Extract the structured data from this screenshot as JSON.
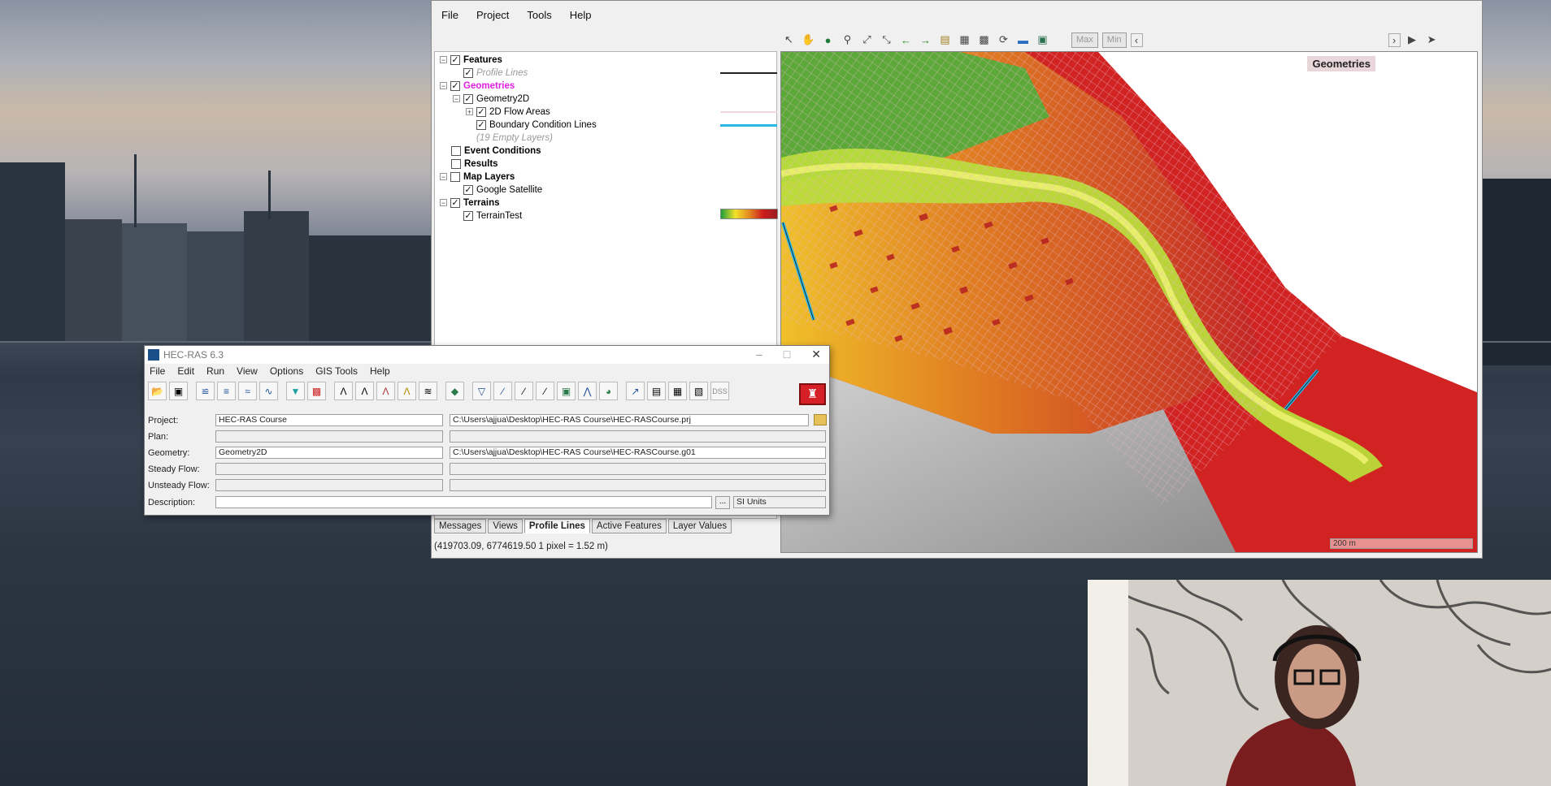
{
  "mapper": {
    "menu": [
      "File",
      "Project",
      "Tools",
      "Help"
    ],
    "toolbar_boxes": [
      "Max",
      "Min"
    ],
    "tree": {
      "features": "Features",
      "profile_lines": "Profile Lines",
      "geometries": "Geometries",
      "geometry2d": "Geometry2D",
      "flow_areas": "2D Flow Areas",
      "bc_lines": "Boundary Condition Lines",
      "empty_layers": "(19 Empty Layers)",
      "event_conditions": "Event Conditions",
      "results": "Results",
      "map_layers": "Map Layers",
      "google_satellite": "Google Satellite",
      "terrains": "Terrains",
      "terrain_test": "TerrainTest"
    },
    "tabs": [
      "Messages",
      "Views",
      "Profile Lines",
      "Active Features",
      "Layer Values"
    ],
    "active_tab": "Profile Lines",
    "status": "(419703.09, 6774619.50  1 pixel = 1.52 m)",
    "map_label": "Geometries",
    "scale_label": "200 m",
    "colors": {
      "geometries_text": "#e020e0",
      "bc_line": "#2ab7e8",
      "profile_line": "#222222"
    }
  },
  "hecras": {
    "title": "HEC-RAS 6.3",
    "menu": [
      "File",
      "Edit",
      "Run",
      "View",
      "Options",
      "GIS Tools",
      "Help"
    ],
    "fields": {
      "project_label": "Project:",
      "project_value": "HEC-RAS Course",
      "project_path": "C:\\Users\\ajjua\\Desktop\\HEC-RAS Course\\HEC-RASCourse.prj",
      "plan_label": "Plan:",
      "geometry_label": "Geometry:",
      "geometry_value": "Geometry2D",
      "geometry_path": "C:\\Users\\ajjua\\Desktop\\HEC-RAS Course\\HEC-RASCourse.g01",
      "steady_label": "Steady Flow:",
      "unsteady_label": "Unsteady Flow:",
      "description_label": "Description:",
      "units": "SI Units",
      "dots": "..."
    },
    "toolbar_last": "DSS"
  }
}
